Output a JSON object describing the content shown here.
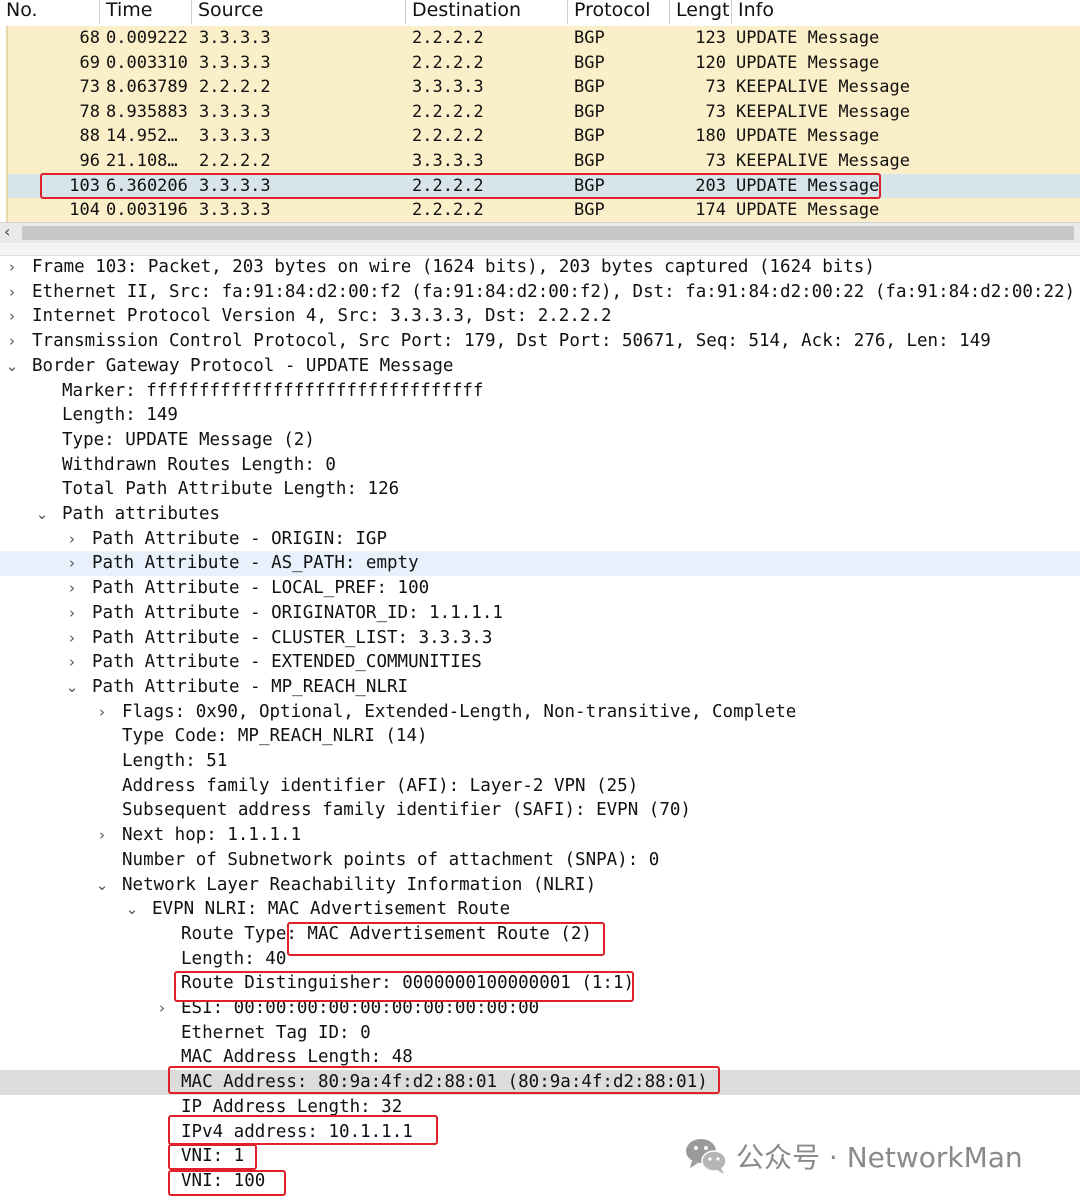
{
  "packet_list": {
    "columns": [
      "No.",
      "Time",
      "Source",
      "Destination",
      "Protocol",
      "Lengt",
      "Info"
    ],
    "rows": [
      {
        "no": "68",
        "time": "0.009222",
        "source": "3.3.3.3",
        "destination": "2.2.2.2",
        "protocol": "BGP",
        "length": "123",
        "info": "UPDATE Message"
      },
      {
        "no": "69",
        "time": "0.003310",
        "source": "3.3.3.3",
        "destination": "2.2.2.2",
        "protocol": "BGP",
        "length": "120",
        "info": "UPDATE Message"
      },
      {
        "no": "73",
        "time": "8.063789",
        "source": "2.2.2.2",
        "destination": "3.3.3.3",
        "protocol": "BGP",
        "length": "73",
        "info": "KEEPALIVE Message"
      },
      {
        "no": "78",
        "time": "8.935883",
        "source": "3.3.3.3",
        "destination": "2.2.2.2",
        "protocol": "BGP",
        "length": "73",
        "info": "KEEPALIVE Message"
      },
      {
        "no": "88",
        "time": "14.952…",
        "source": "3.3.3.3",
        "destination": "2.2.2.2",
        "protocol": "BGP",
        "length": "180",
        "info": "UPDATE Message"
      },
      {
        "no": "96",
        "time": "21.108…",
        "source": "2.2.2.2",
        "destination": "3.3.3.3",
        "protocol": "BGP",
        "length": "73",
        "info": "KEEPALIVE Message"
      },
      {
        "no": "103",
        "time": "6.360206",
        "source": "3.3.3.3",
        "destination": "2.2.2.2",
        "protocol": "BGP",
        "length": "203",
        "info": "UPDATE Message",
        "selected": true
      },
      {
        "no": "104",
        "time": "0.003196",
        "source": "3.3.3.3",
        "destination": "2.2.2.2",
        "protocol": "BGP",
        "length": "174",
        "info": "UPDATE Message"
      }
    ]
  },
  "details": [
    {
      "text": "Frame 103: Packet, 203 bytes on wire (1624 bits), 203 bytes captured (1624 bits)",
      "level": 0,
      "expander": "collapsed"
    },
    {
      "text": "Ethernet II, Src: fa:91:84:d2:00:f2 (fa:91:84:d2:00:f2), Dst: fa:91:84:d2:00:22 (fa:91:84:d2:00:22)",
      "level": 0,
      "expander": "collapsed"
    },
    {
      "text": "Internet Protocol Version 4, Src: 3.3.3.3, Dst: 2.2.2.2",
      "level": 0,
      "expander": "collapsed"
    },
    {
      "text": "Transmission Control Protocol, Src Port: 179, Dst Port: 50671, Seq: 514, Ack: 276, Len: 149",
      "level": 0,
      "expander": "collapsed"
    },
    {
      "text": "Border Gateway Protocol - UPDATE Message",
      "level": 0,
      "expander": "expanded"
    },
    {
      "text": "Marker: ffffffffffffffffffffffffffffffff",
      "level": 1,
      "expander": "none"
    },
    {
      "text": "Length: 149",
      "level": 1,
      "expander": "none"
    },
    {
      "text": "Type: UPDATE Message (2)",
      "level": 1,
      "expander": "none"
    },
    {
      "text": "Withdrawn Routes Length: 0",
      "level": 1,
      "expander": "none"
    },
    {
      "text": "Total Path Attribute Length: 126",
      "level": 1,
      "expander": "none"
    },
    {
      "text": "Path attributes",
      "level": 1,
      "expander": "expanded"
    },
    {
      "text": "Path Attribute - ORIGIN: IGP",
      "level": 2,
      "expander": "collapsed"
    },
    {
      "text": "Path Attribute - AS_PATH: empty",
      "level": 2,
      "expander": "collapsed",
      "highlight": "blue"
    },
    {
      "text": "Path Attribute - LOCAL_PREF: 100",
      "level": 2,
      "expander": "collapsed"
    },
    {
      "text": "Path Attribute - ORIGINATOR_ID: 1.1.1.1",
      "level": 2,
      "expander": "collapsed"
    },
    {
      "text": "Path Attribute - CLUSTER_LIST: 3.3.3.3",
      "level": 2,
      "expander": "collapsed"
    },
    {
      "text": "Path Attribute - EXTENDED_COMMUNITIES",
      "level": 2,
      "expander": "collapsed"
    },
    {
      "text": "Path Attribute - MP_REACH_NLRI",
      "level": 2,
      "expander": "expanded"
    },
    {
      "text": "Flags: 0x90, Optional, Extended-Length, Non-transitive, Complete",
      "level": 3,
      "expander": "collapsed"
    },
    {
      "text": "Type Code: MP_REACH_NLRI (14)",
      "level": 3,
      "expander": "none"
    },
    {
      "text": "Length: 51",
      "level": 3,
      "expander": "none"
    },
    {
      "text": "Address family identifier (AFI): Layer-2 VPN (25)",
      "level": 3,
      "expander": "none"
    },
    {
      "text": "Subsequent address family identifier (SAFI): EVPN (70)",
      "level": 3,
      "expander": "none"
    },
    {
      "text": "Next hop: 1.1.1.1",
      "level": 3,
      "expander": "collapsed"
    },
    {
      "text": "Number of Subnetwork points of attachment (SNPA): 0",
      "level": 3,
      "expander": "none"
    },
    {
      "text": "Network Layer Reachability Information (NLRI)",
      "level": 3,
      "expander": "expanded"
    },
    {
      "text": "EVPN NLRI: MAC Advertisement Route",
      "level": 4,
      "expander": "expanded"
    },
    {
      "text": "Route Type: MAC Advertisement Route (2)",
      "level": 5,
      "expander": "none"
    },
    {
      "text": "Length: 40",
      "level": 5,
      "expander": "none"
    },
    {
      "text": "Route Distinguisher: 0000000100000001 (1:1)",
      "level": 5,
      "expander": "none"
    },
    {
      "text": "ESI: 00:00:00:00:00:00:00:00:00:00",
      "level": 5,
      "expander": "collapsed"
    },
    {
      "text": "Ethernet Tag ID: 0",
      "level": 5,
      "expander": "none"
    },
    {
      "text": "MAC Address Length: 48",
      "level": 5,
      "expander": "none"
    },
    {
      "text": "MAC Address: 80:9a:4f:d2:88:01 (80:9a:4f:d2:88:01)",
      "level": 5,
      "expander": "none",
      "highlight": "gray"
    },
    {
      "text": "IP Address Length: 32",
      "level": 5,
      "expander": "none"
    },
    {
      "text": "IPv4 address: 10.1.1.1",
      "level": 5,
      "expander": "none"
    },
    {
      "text": "VNI: 1",
      "level": 5,
      "expander": "none"
    },
    {
      "text": "VNI: 100",
      "level": 5,
      "expander": "none"
    }
  ],
  "watermark": {
    "text": "公众号 · NetworkMan",
    "icon": "wechat-icon"
  },
  "colors": {
    "row_bg": "#fbefc9",
    "selected_row_bg": "#d7e4ea",
    "annotation_red": "#e0202a",
    "hover_blue": "#e8f0fb",
    "selected_detail_gray": "#dcdcdc"
  }
}
